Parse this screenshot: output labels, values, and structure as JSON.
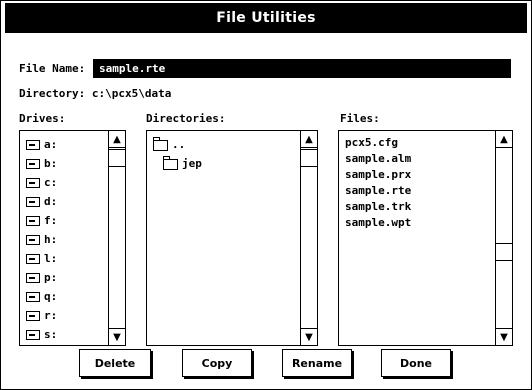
{
  "dialog": {
    "title": "File Utilities"
  },
  "file_name": {
    "label": "File Name:",
    "value": "sample.rte"
  },
  "directory": {
    "label": "Directory:",
    "value": "c:\\pcx5\\data"
  },
  "drives": {
    "label": "Drives:",
    "items": [
      "a:",
      "b:",
      "c:",
      "d:",
      "f:",
      "h:",
      "l:",
      "p:",
      "q:",
      "r:",
      "s:"
    ]
  },
  "directories": {
    "label": "Directories:",
    "items": [
      "..",
      "jep"
    ]
  },
  "files": {
    "label": "Files:",
    "items": [
      "pcx5.cfg",
      "sample.alm",
      "sample.prx",
      "sample.rte",
      "sample.trk",
      "sample.wpt"
    ]
  },
  "buttons": {
    "delete": "Delete",
    "copy": "Copy",
    "rename": "Rename",
    "done": "Done"
  },
  "scroll": {
    "up": "▲",
    "down": "▼"
  }
}
